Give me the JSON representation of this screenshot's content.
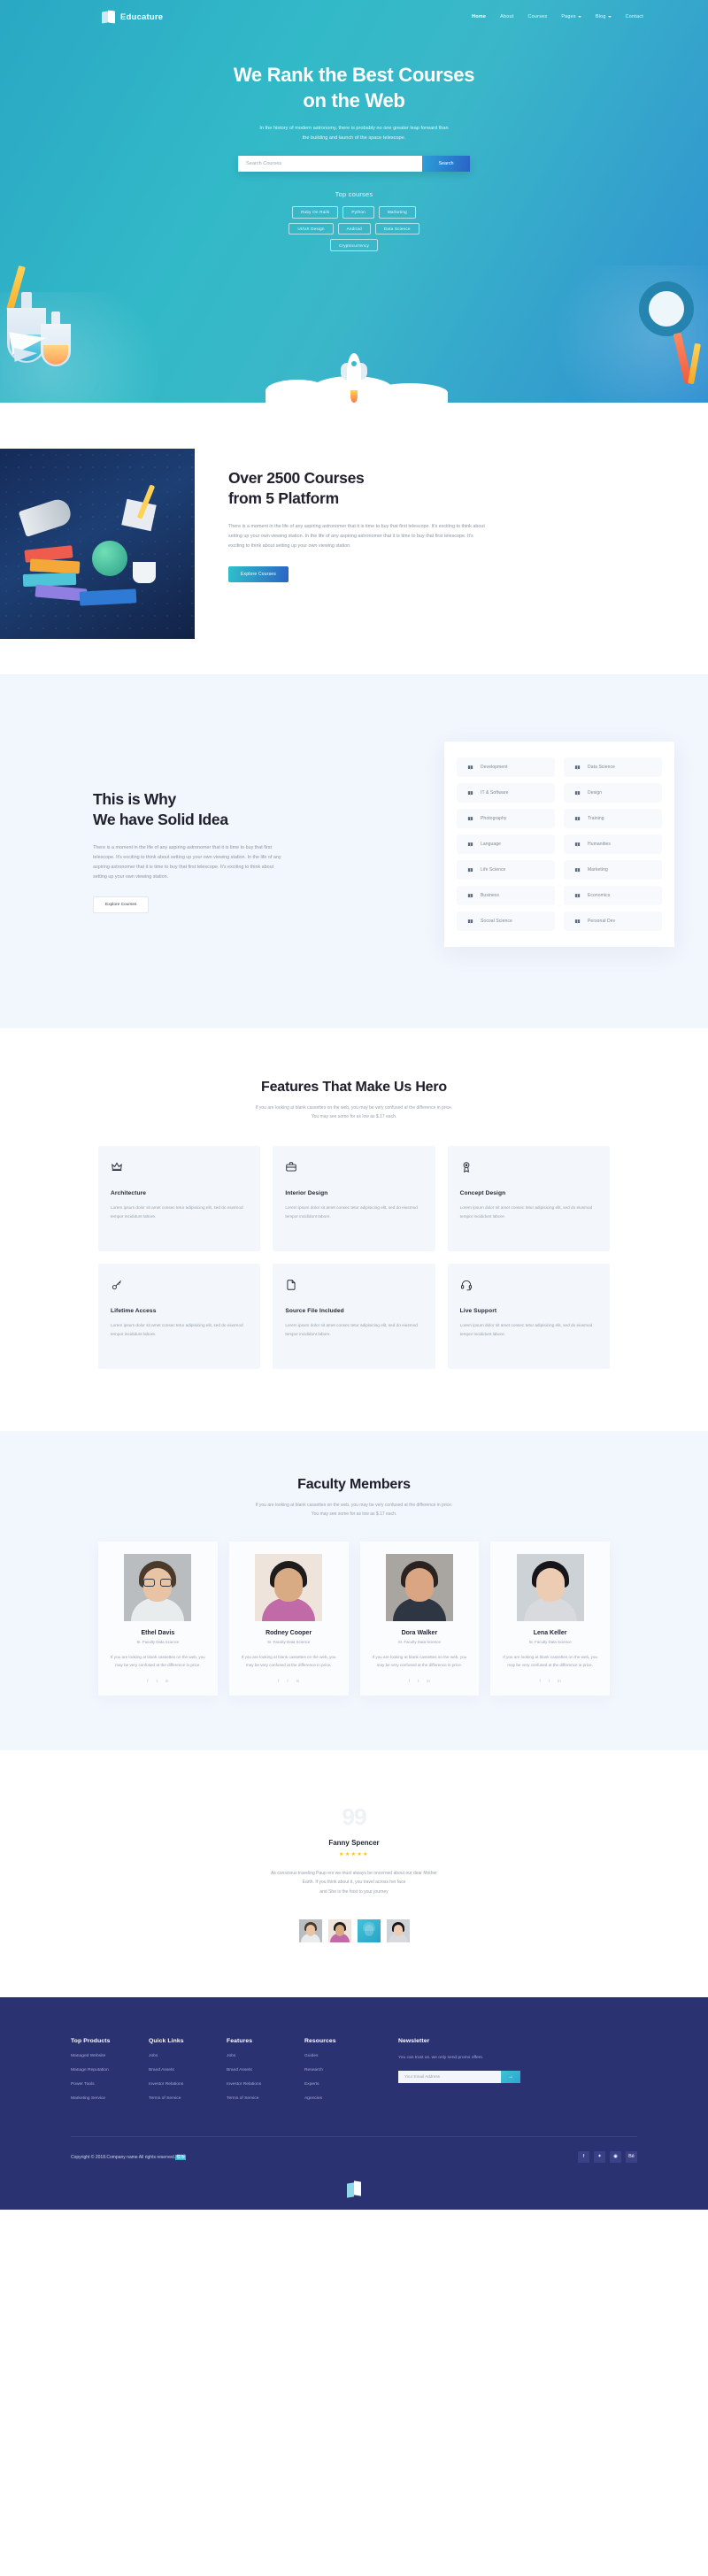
{
  "brand": {
    "name": "Educature",
    "logo_icon": "book-logo-icon"
  },
  "nav": {
    "items": [
      {
        "label": "Home",
        "active": true,
        "dropdown": false
      },
      {
        "label": "About",
        "active": false,
        "dropdown": false
      },
      {
        "label": "Courses",
        "active": false,
        "dropdown": false
      },
      {
        "label": "Pages",
        "active": false,
        "dropdown": true
      },
      {
        "label": "Blog",
        "active": false,
        "dropdown": true
      },
      {
        "label": "Contact",
        "active": false,
        "dropdown": false
      }
    ]
  },
  "hero": {
    "title_line1": "We Rank the Best Courses",
    "title_line2": "on the Web",
    "subtitle_line1": "In the history of modern astronomy, there is probably no one greater leap forward than",
    "subtitle_line2": "the building and launch of the space telescope.",
    "search_placeholder": "Search Courses",
    "search_value": "",
    "search_button": "Search",
    "top_courses_label": "Top courses",
    "tags_row1": [
      "Ruby On Rails",
      "Python",
      "Marketing"
    ],
    "tags_row2": [
      "UI/UX Design",
      "Android",
      "Data Science"
    ],
    "tags_row3": [
      "Cryptocurrency"
    ]
  },
  "promo": {
    "title_line1": "Over 2500 Courses",
    "title_line2": "from 5 Platform",
    "body": "There is a moment in the life of any aspiring astronomer that it is time to buy that first telescope. It's exciting to think about setting up your own viewing station. In the life of any aspiring astronomer that it is time to buy that first telescope. It's exciting to think about setting up your own viewing station.",
    "button": "Explore Courses"
  },
  "idea": {
    "title_line1": "This is Why",
    "title_line2": "We have Solid Idea",
    "body": "There is a moment in the life of any aspiring astronomer that it is time to buy that first telescope. It's exciting to think about setting up your own viewing station. In the life of any aspiring astronomer that it is time to buy that first telescope. It's exciting to think about setting up your own viewing station.",
    "button": "Explore Courses",
    "categories": [
      "Development",
      "Data Science",
      "IT & Software",
      "Design",
      "Photography",
      "Training",
      "Language",
      "Humanities",
      "Life Science",
      "Marketing",
      "Business",
      "Economics",
      "Socoal Science",
      "Personal Dev"
    ]
  },
  "features": {
    "title": "Features That Make Us Hero",
    "sub_line1": "If you are looking at blank cassettes on the web, you may be very confused at the difference in price.",
    "sub_line2": "You may see some for as low as $.17 each.",
    "cards": [
      {
        "icon": "crown-icon",
        "title": "Architecture",
        "desc": "Lorem ipsum dolor sit amet consec tetur adipisicing elit, sed do eiusmod tempor incididunt labore."
      },
      {
        "icon": "briefcase-icon",
        "title": "Interior Design",
        "desc": "Lorem ipsum dolor sit amet consec tetur adipisicing elit, sed do eiusmod tempor incididunt labore."
      },
      {
        "icon": "badge-icon",
        "title": "Concept Design",
        "desc": "Lorem ipsum dolor sit amet consec tetur adipisicing elit, sed do eiusmod tempor incididunt labore."
      },
      {
        "icon": "key-icon",
        "title": "Lifetime Access",
        "desc": "Lorem ipsum dolor sit amet consec tetur adipisicing elit, sed do eiusmod tempor incididunt labore."
      },
      {
        "icon": "file-icon",
        "title": "Source File Included",
        "desc": "Lorem ipsum dolor sit amet consec tetur adipisicing elit, sed do eiusmod tempor incididunt labore."
      },
      {
        "icon": "headset-icon",
        "title": "Live Support",
        "desc": "Lorem ipsum dolor sit amet consec tetur adipisicing elit, sed do eiusmod tempor incididunt labore."
      }
    ]
  },
  "faculty": {
    "title": "Faculty Members",
    "sub_line1": "If you are looking at blank cassettes on the web, you may be very confused at the difference in price.",
    "sub_line2": "You may see some for as low as $.17 each.",
    "members": [
      {
        "name": "Ethel Davis",
        "role": "Sr. Faculty Data Science",
        "bio": "If you are looking at blank cassettes on the web, you may be very confused at the difference in price.",
        "hair": "#4a3a2c",
        "skin": "#e8c3a4",
        "body": "#e9eced",
        "bg": "#b9bdc0",
        "glasses": true
      },
      {
        "name": "Rodney Cooper",
        "role": "Sr. Faculty Data Science",
        "bio": "If you are looking at blank cassettes on the web, you may be very confused at the difference in price.",
        "hair": "#1d1b1c",
        "skin": "#d9ab85",
        "body": "#c06aa8",
        "bg": "#efe4dc",
        "glasses": false
      },
      {
        "name": "Dora Walker",
        "role": "Sr. Faculty Data Science",
        "bio": "If you are looking at blank cassettes on the web, you may be very confused at the difference in price.",
        "hair": "#2a2321",
        "skin": "#d9a583",
        "body": "#2f3643",
        "bg": "#a9a5a1",
        "glasses": false
      },
      {
        "name": "Lena Keller",
        "role": "Sr. Faculty Data Science",
        "bio": "If you are looking at blank cassettes on the web, you may be very confused at the difference in price.",
        "hair": "#17151a",
        "skin": "#eccdb4",
        "body": "#d8dadd",
        "bg": "#cdd2d6",
        "glasses": false
      }
    ],
    "social_icons": [
      "facebook-icon",
      "twitter-icon",
      "linkedin-icon"
    ]
  },
  "testimonial": {
    "quote_mark": "99",
    "name": "Fanny Spencer",
    "stars": "★★★★★",
    "rating": 5,
    "text_line1": "As conscious traveling Paup ers we must always be oncerned about our dear Mother",
    "text_line2": "Earth. If you think about it, you travel across her face",
    "text_line3": "and She is the host to your journey",
    "active_index": 2
  },
  "footer": {
    "columns": [
      {
        "heading": "Top Products",
        "links": [
          "Managed Website",
          "Manage Reputation",
          "Power Tools",
          "Marketing Service"
        ]
      },
      {
        "heading": "Quick Links",
        "links": [
          "Jobs",
          "Brand Assets",
          "Investor Relations",
          "Terms of Service"
        ]
      },
      {
        "heading": "Features",
        "links": [
          "Jobs",
          "Brand Assets",
          "Investor Relations",
          "Terms of Service"
        ]
      },
      {
        "heading": "Resources",
        "links": [
          "Guides",
          "Research",
          "Experts",
          "Agencies"
        ]
      }
    ],
    "newsletter": {
      "heading": "Newsletter",
      "text": "You can trust us. we only send promo offers.",
      "placeholder": "Your Email Address",
      "value": "",
      "submit_icon": "arrow-right-icon"
    },
    "copyright_prefix": "Copyright © 2018.Company name All rights reserved.",
    "copyright_badge": "模板",
    "socials": [
      "facebook-icon",
      "twitter-icon",
      "dribbble-icon",
      "behance-icon"
    ],
    "social_glyphs": [
      "f",
      "𝐓",
      "ⓑ",
      "Bē"
    ]
  },
  "colors": {
    "hero_gradient_start": "#2aa8c4",
    "hero_gradient_end": "#2f8fd0",
    "accent_blue": "#2a63c6",
    "accent_teal": "#2fc1c9",
    "footer_bg": "#2b3272",
    "section_bg": "#f2f6fd",
    "star": "#ffc107"
  }
}
